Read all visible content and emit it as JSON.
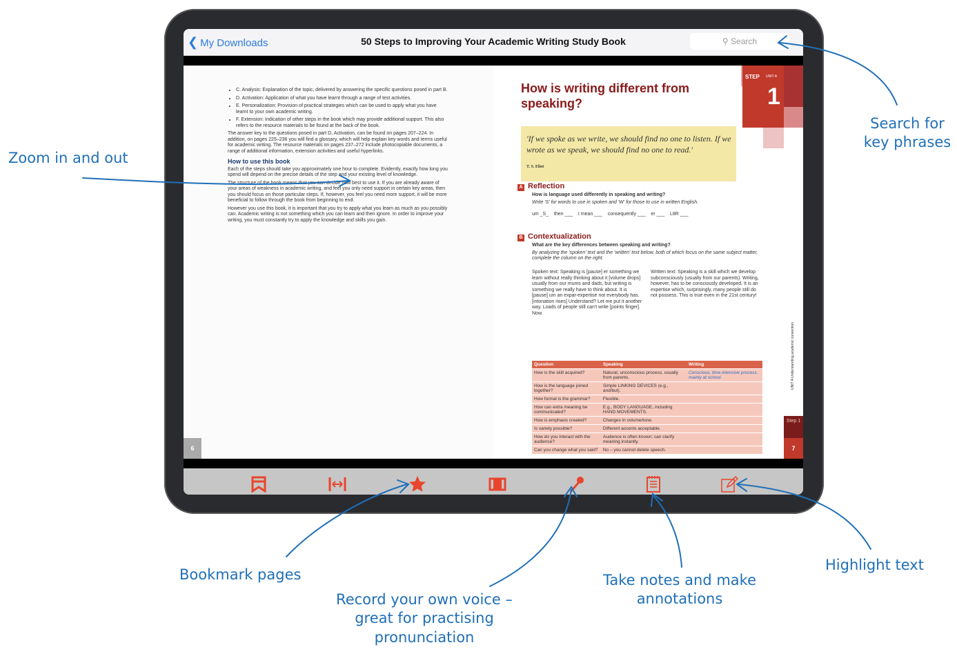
{
  "app": {
    "back_label": "My Downloads",
    "title": "50 Steps to Improving Your Academic Writing Study Book",
    "search_placeholder": "Search"
  },
  "left_page": {
    "bullets": [
      "C. Analysis: Explanation of the topic, delivered by answering the specific questions posed in part B.",
      "D. Activation: Application of what you have learnt through a range of test activities.",
      "E. Personalization: Provision of practical strategies which can be used to apply what you have learnt to your own academic writing.",
      "F. Extension: Indication of other steps in the book which may provide additional support. This also refers to the resource materials to be found at the back of the book."
    ],
    "para1": "The answer key to the questions posed in part D, Activation, can be found on pages 207–224. In addition, on pages 225–236 you will find a glossary, which will help explain key words and terms useful for academic writing. The resource materials on pages 237–272 include photocopiable documents, a range of additional information, extension activities and useful hyperlinks.",
    "heading": "How to use this book",
    "para2": "Each of the steps should take you approximately one hour to complete. Evidently, exactly how long you spend will depend on the precise details of the step and your existing level of knowledge.",
    "para3": "The structure of the book means that you can decide how best to use it. If you are already aware of your areas of weakness in academic writing, and feel you only need support in certain key areas, then you should focus on those particular steps. If, however, you feel you need more support, it will be more beneficial to follow through the book from beginning to end.",
    "para4": "However you use this book, it is important that you try to apply what you learn as much as you possibly can. Academic writing is not something which you can learn and then ignore. In order to improve your writing, you must constantly try to apply the knowledge and skills you gain.",
    "page_number": "6"
  },
  "right_page": {
    "step_label": "STEP",
    "unit_label": "UNIT A",
    "step_number": "1",
    "heading": "How is writing different from speaking?",
    "quote": "'If we spoke as we write, we should find no one to listen. If we wrote as we speak, we should find no one to read.'",
    "quote_author": "T. S. Eliot",
    "sectionA_letter": "A",
    "sectionA_title": "Reflection",
    "sectionA_question": "How is language used differently in speaking and writing?",
    "sectionA_instruction": "Write 'S' for words to use in spoken and 'W' for those to use in written English.",
    "sectionA_words": "um _S_    then ___    I mean ___    consequently ___    er ___    L8R ___",
    "sectionB_letter": "B",
    "sectionB_title": "Contextualization",
    "sectionB_question": "What are the key differences between speaking and writing?",
    "sectionB_instruction": "By analyzing the 'spoken' text and the 'written' text below, both of which focus on the same subject matter, complete the column on the right.",
    "spoken_text": "Spoken text: Speaking is [pause] er something we learn without really thinking about it [volume drops] usually from our mums and dads, but writing is something we really have to think about. It is [pause] um an expar-expertise not everybody has. [intonation rises] Understand? Let me put it another way. Loads of people still can't write [points finger]. Now.",
    "written_text": "Written text: Speaking is a skill which we develop subconsciously (usually from our parents). Writing, however, has to be consciously developed. It is an expertise which, surprisingly, many people still do not possess. This is true even in the 21st century!",
    "table_headers": [
      "Question",
      "Speaking",
      "Writing"
    ],
    "table_rows": [
      [
        "How is the skill acquired?",
        "Natural, unconscious process, usually from parents.",
        "Conscious, time-intensive process, mainly at school."
      ],
      [
        "How is the language joined together?",
        "Simple LINKING DEVICES (e.g., and/but).",
        ""
      ],
      [
        "How formal is the grammar?",
        "Flexible.",
        ""
      ],
      [
        "How can extra meaning be communicated?",
        "E.g., BODY LANGUAGE, including HAND MOVEMENTS.",
        ""
      ],
      [
        "How is emphasis created?",
        "Changes in volume/tone.",
        ""
      ],
      [
        "Is variety possible?",
        "Different accents acceptable.",
        ""
      ],
      [
        "How do you interact with the audience?",
        "Audience is often known; can clarify meaning instantly.",
        ""
      ],
      [
        "Can you change what you said?",
        "No – you cannot delete speech.",
        ""
      ]
    ],
    "side_label": "UNIT A  Understanding academic convention",
    "side_step": "Step 1",
    "page_number": "7"
  },
  "toolbar": {
    "icons": [
      "bookmark-icon",
      "fit-width-icon",
      "star-icon",
      "columns-icon",
      "microphone-icon",
      "notes-icon",
      "highlight-icon"
    ]
  },
  "annotations": {
    "zoom": "Zoom in and out",
    "search": "Search for key phrases",
    "bookmark": "Bookmark pages",
    "record": "Record your own voice – great for practising pronunciation",
    "notes": "Take notes and make annotations",
    "highlight": "Highlight text"
  },
  "colors": {
    "accent": "#e8452c",
    "annotation": "#1f6fb8",
    "heading_red": "#8b1a1a"
  }
}
